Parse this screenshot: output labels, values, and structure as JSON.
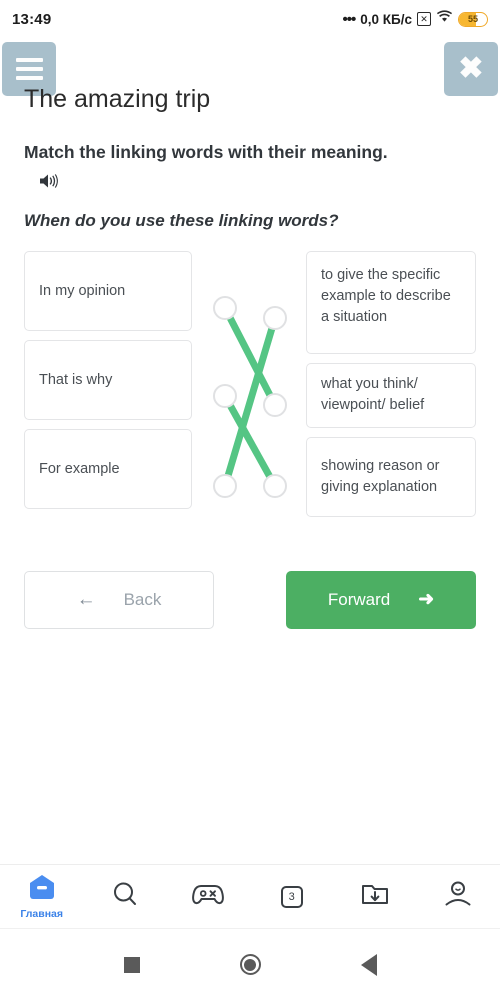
{
  "statusbar": {
    "time": "13:49",
    "dots": "•••",
    "network_speed": "0,0 КБ/с",
    "x_icon": "x-close-icon",
    "wifi_icon": "wifi-icon",
    "battery_level": "55",
    "battery_percent": 55
  },
  "header": {
    "menu_icon": "hamburger-menu-icon",
    "close_icon": "close-icon",
    "title": "The amazing trip"
  },
  "exercise": {
    "instruction": "Match the linking words with their meaning.",
    "sound_icon": "speaker-sound-icon",
    "subtitle": "When do you use these linking words?",
    "left_items": [
      {
        "id": "l1",
        "label": "In my opinion"
      },
      {
        "id": "l2",
        "label": "That is why"
      },
      {
        "id": "l3",
        "label": "For example"
      }
    ],
    "right_items": [
      {
        "id": "r1",
        "label": "to give the specific example to describe a situation"
      },
      {
        "id": "r2",
        "label": "what you think/ viewpoint/ belief"
      },
      {
        "id": "r3",
        "label": "showing reason or giving explanation"
      }
    ],
    "connections": [
      {
        "from": "l1",
        "to": "r2"
      },
      {
        "from": "l2",
        "to": "r3"
      },
      {
        "from": "l3",
        "to": "r1"
      }
    ],
    "line_color": "#55c584",
    "dot_border_color": "#e0e1e3"
  },
  "nav": {
    "back_label": "Back",
    "back_arrow": "arrow-left-icon",
    "forward_label": "Forward",
    "forward_arrow": "arrow-right-icon",
    "forward_color": "#4caf63"
  },
  "browser_nav": {
    "accent_color": "#3b82e8",
    "items": [
      {
        "icon": "home-icon",
        "label": "Главная",
        "active": true
      },
      {
        "icon": "search-icon",
        "label": "",
        "active": false
      },
      {
        "icon": "gamepad-icon",
        "label": "",
        "active": false
      },
      {
        "icon": "tabs-icon",
        "label": "3",
        "active": false
      },
      {
        "icon": "downloads-folder-icon",
        "label": "",
        "active": false
      },
      {
        "icon": "profile-icon",
        "label": "",
        "active": false
      }
    ],
    "tab_count": "3"
  },
  "system_nav": {
    "recents_icon": "square-recents-icon",
    "home_icon": "circle-home-icon",
    "back_icon": "triangle-back-icon"
  }
}
